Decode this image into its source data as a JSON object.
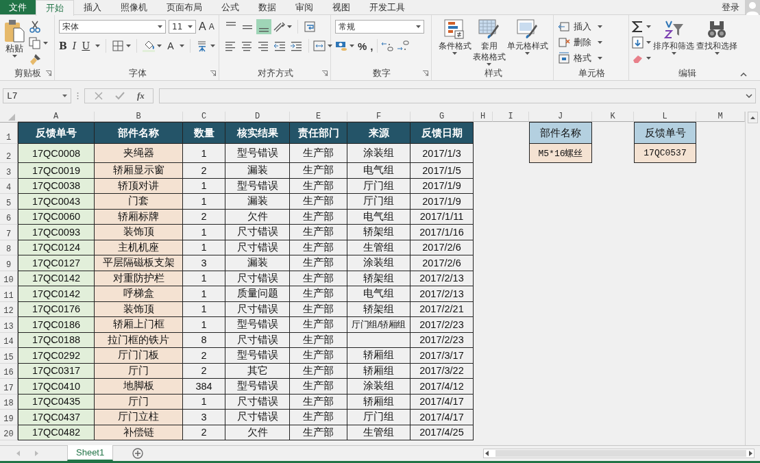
{
  "tabs": [
    {
      "label": "文件",
      "kind": "file",
      "selected": false
    },
    {
      "label": "开始",
      "kind": "tab",
      "selected": true
    },
    {
      "label": "插入",
      "kind": "tab",
      "selected": false
    },
    {
      "label": "照像机",
      "kind": "tab",
      "selected": false
    },
    {
      "label": "页面布局",
      "kind": "tab",
      "selected": false
    },
    {
      "label": "公式",
      "kind": "tab",
      "selected": false
    },
    {
      "label": "数据",
      "kind": "tab",
      "selected": false
    },
    {
      "label": "审阅",
      "kind": "tab",
      "selected": false
    },
    {
      "label": "视图",
      "kind": "tab",
      "selected": false
    },
    {
      "label": "开发工具",
      "kind": "tab",
      "selected": false
    }
  ],
  "account": {
    "label": "登录"
  },
  "ribbon": {
    "clipboard": {
      "label": "剪贴板",
      "paste": "粘贴"
    },
    "font": {
      "label": "字体",
      "font_name": "宋体",
      "font_size": "11",
      "size_buttons": [
        "A",
        "A"
      ],
      "styles": [
        "B",
        "I",
        "U"
      ],
      "color_button": "A"
    },
    "alignment": {
      "label": "对齐方式"
    },
    "number": {
      "label": "数字",
      "format": "常规",
      "buttons": [
        "%",
        ","
      ]
    },
    "styles": {
      "label": "样式",
      "buttons": [
        {
          "lines": [
            "条件格式"
          ]
        },
        {
          "lines": [
            "套用",
            "表格格式"
          ]
        },
        {
          "lines": [
            "单元格样式"
          ]
        }
      ]
    },
    "cells": {
      "label": "单元格",
      "buttons": [
        "插入",
        "删除",
        "格式"
      ]
    },
    "editing": {
      "label": "编辑",
      "buttons": [
        "排序和筛选",
        "查找和选择"
      ]
    }
  },
  "formula_bar": {
    "name_box": "L7",
    "function_label": "fx"
  },
  "sheet": {
    "column_letters": [
      "A",
      "B",
      "C",
      "D",
      "E",
      "F",
      "G",
      "H",
      "I",
      "J",
      "K",
      "L",
      "M"
    ],
    "row_numbers": [
      "1",
      "2",
      "3",
      "4",
      "5",
      "6",
      "7",
      "8",
      "9",
      "10",
      "11",
      "12",
      "13",
      "14",
      "15",
      "16",
      "17",
      "18",
      "19",
      "20"
    ],
    "table": {
      "columns": [
        {
          "header": "反馈单号",
          "color": "#e2efda"
        },
        {
          "header": "部件名称",
          "color": "#f4e2d2"
        },
        {
          "header": "数量",
          "color": "#f0f0f0"
        },
        {
          "header": "核实结果",
          "color": "#f0f0f0"
        },
        {
          "header": "责任部门",
          "color": "#f0f0f0"
        },
        {
          "header": "来源",
          "color": "#f0f0f0"
        },
        {
          "header": "反馈日期",
          "color": "#f0f0f0"
        }
      ],
      "rows": [
        [
          "17QC0008",
          "夹绳器",
          "1",
          "型号错误",
          "生产部",
          "涂装组",
          "2017/1/3"
        ],
        [
          "17QC0019",
          "轿厢显示窗",
          "2",
          "漏装",
          "生产部",
          "电气组",
          "2017/1/5"
        ],
        [
          "17QC0038",
          "轿顶对讲",
          "1",
          "型号错误",
          "生产部",
          "厅门组",
          "2017/1/9"
        ],
        [
          "17QC0043",
          "门套",
          "1",
          "漏装",
          "生产部",
          "厅门组",
          "2017/1/9"
        ],
        [
          "17QC0060",
          "轿厢标牌",
          "2",
          "欠件",
          "生产部",
          "电气组",
          "2017/1/11"
        ],
        [
          "17QC0093",
          "装饰顶",
          "1",
          "尺寸错误",
          "生产部",
          "轿架组",
          "2017/1/16"
        ],
        [
          "17QC0124",
          "主机机座",
          "1",
          "尺寸错误",
          "生产部",
          "生管组",
          "2017/2/6"
        ],
        [
          "17QC0127",
          "平层隔磁板支架",
          "3",
          "漏装",
          "生产部",
          "涂装组",
          "2017/2/6"
        ],
        [
          "17QC0142",
          "对重防护栏",
          "1",
          "尺寸错误",
          "生产部",
          "轿架组",
          "2017/2/13"
        ],
        [
          "17QC0142",
          "呼梯盒",
          "1",
          "质量问题",
          "生产部",
          "电气组",
          "2017/2/13"
        ],
        [
          "17QC0176",
          "装饰顶",
          "1",
          "尺寸错误",
          "生产部",
          "轿架组",
          "2017/2/21"
        ],
        [
          "17QC0186",
          "轿厢上门框",
          "1",
          "型号错误",
          "生产部",
          "厅门组/轿厢组",
          "2017/2/23"
        ],
        [
          "17QC0188",
          "拉门框的铁片",
          "8",
          "尺寸错误",
          "生产部",
          null,
          "2017/2/23"
        ],
        [
          "17QC0292",
          "厅门门板",
          "2",
          "型号错误",
          "生产部",
          "轿厢组",
          "2017/3/17"
        ],
        [
          "17QC0317",
          "厅门",
          "2",
          "其它",
          "生产部",
          "轿厢组",
          "2017/3/22"
        ],
        [
          "17QC0410",
          "地脚板",
          "384",
          "型号错误",
          "生产部",
          "涂装组",
          "2017/4/12"
        ],
        [
          "17QC0435",
          "厅门",
          "1",
          "尺寸错误",
          "生产部",
          "轿厢组",
          "2017/4/17"
        ],
        [
          "17QC0437",
          "厅门立柱",
          "3",
          "尺寸错误",
          "生产部",
          "厅门组",
          "2017/4/17"
        ],
        [
          "17QC0482",
          "补偿链",
          "2",
          "欠件",
          "生产部",
          "生管组",
          "2017/4/25"
        ]
      ]
    },
    "lookups": [
      {
        "header": "部件名称",
        "value": "M5*16螺丝"
      },
      {
        "header": "反馈单号",
        "value": "17QC0537"
      }
    ]
  },
  "sheet_tabs": [
    {
      "label": "Sheet1",
      "selected": true
    }
  ]
}
